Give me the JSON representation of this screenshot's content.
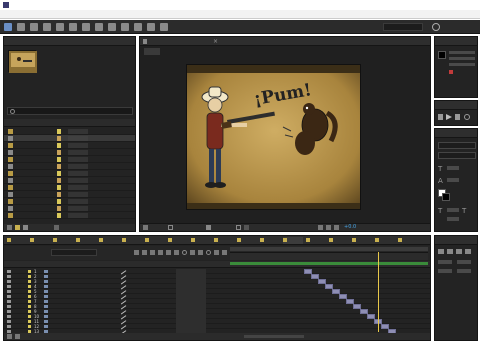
{
  "window": {
    "title": "",
    "menu": [
      "",
      "",
      "",
      "",
      "",
      "",
      "",
      "",
      ""
    ]
  },
  "toolbar": {
    "tools": [
      "selection",
      "hand",
      "zoom",
      "camera",
      "pan",
      "mask",
      "pen",
      "type",
      "brush",
      "clone",
      "eraser",
      "roto",
      "puppet"
    ],
    "workspace_label": "",
    "search_placeholder": ""
  },
  "project_panel": {
    "tab_label": "",
    "item_name": "",
    "item_details": "",
    "search_value": "",
    "columns": [
      "",
      "",
      "",
      "",
      ""
    ],
    "items": [
      {
        "name": "",
        "kind": "folder",
        "label_color": "#d9c95a"
      },
      {
        "name": "",
        "kind": "comp",
        "label_color": "#c9a35a"
      },
      {
        "name": "",
        "kind": "folder",
        "label_color": "#d9c95a"
      },
      {
        "name": "",
        "kind": "comp",
        "label_color": "#c9a35a"
      },
      {
        "name": "",
        "kind": "folder",
        "label_color": "#d9c95a"
      },
      {
        "name": "",
        "kind": "comp",
        "label_color": "#c9a35a"
      },
      {
        "name": "",
        "kind": "folder",
        "label_color": "#d9c95a"
      },
      {
        "name": "",
        "kind": "comp",
        "label_color": "#c9a35a"
      },
      {
        "name": "",
        "kind": "folder",
        "label_color": "#d9c95a"
      },
      {
        "name": "",
        "kind": "comp",
        "label_color": "#c9a35a"
      },
      {
        "name": "",
        "kind": "folder",
        "label_color": "#d9c95a"
      },
      {
        "name": "",
        "kind": "comp",
        "label_color": "#c9a35a"
      },
      {
        "name": "",
        "kind": "folder",
        "label_color": "#d9c95a"
      }
    ],
    "footer_value": ""
  },
  "viewer": {
    "tab_label": "",
    "layer_tab_label": "",
    "comp_tag": "",
    "artwork_text": "¡Pum!",
    "footer_zoom": "",
    "footer_time": "",
    "footer_resolution": "",
    "footer_camera": "",
    "footer_views": ""
  },
  "right_panels": {
    "info_tab": "",
    "preview_tab": "",
    "effects_tab": "",
    "character_tab": "",
    "paragraph_tab": "",
    "font_name": "",
    "font_style": ""
  },
  "timeline": {
    "comp_tabs": [
      "",
      "",
      "",
      "",
      "",
      "",
      "",
      "",
      "",
      "",
      "",
      "",
      "",
      "",
      "",
      "",
      "",
      ""
    ],
    "current_time": "",
    "frame_info": "",
    "search_placeholder": "",
    "columns": [
      "",
      "",
      "",
      "",
      ""
    ],
    "ruler_marks": [
      "",
      "",
      "",
      "",
      ""
    ],
    "layers": [
      {
        "index": "1",
        "name": "",
        "parent": ""
      },
      {
        "index": "2",
        "name": "",
        "parent": ""
      },
      {
        "index": "3",
        "name": "",
        "parent": ""
      },
      {
        "index": "4",
        "name": "",
        "parent": ""
      },
      {
        "index": "5",
        "name": "",
        "parent": ""
      },
      {
        "index": "6",
        "name": "",
        "parent": ""
      },
      {
        "index": "7",
        "name": "",
        "parent": ""
      },
      {
        "index": "8",
        "name": "",
        "parent": ""
      },
      {
        "index": "9",
        "name": "",
        "parent": ""
      },
      {
        "index": "10",
        "name": "",
        "parent": ""
      },
      {
        "index": "11",
        "name": "",
        "parent": ""
      },
      {
        "index": "12",
        "name": "",
        "parent": ""
      },
      {
        "index": "13",
        "name": "",
        "parent": ""
      }
    ],
    "footer_label": ""
  },
  "colors": {
    "ui_dark": "#232323",
    "accent_time": "#e8c84a",
    "layer_bar": "#8e8eb4",
    "label_yellow": "#d9c95a"
  }
}
